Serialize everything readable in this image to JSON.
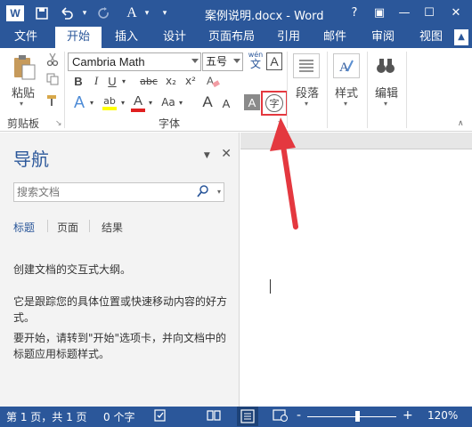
{
  "window": {
    "title": "案例说明.docx - Word",
    "help": "?",
    "ribbon_display": "▣",
    "minimize": "—",
    "maximize": "☐",
    "close": "✕"
  },
  "quick_access": {
    "app_logo": "W",
    "undo_arrow": "▾",
    "customize": "▾"
  },
  "tabs": {
    "file": "文件",
    "items": [
      "开始",
      "插入",
      "设计",
      "页面布局",
      "引用",
      "邮件",
      "审阅",
      "视图"
    ],
    "active": "开始"
  },
  "ribbon": {
    "clipboard": {
      "paste_label": "粘贴",
      "group_label": "剪贴板"
    },
    "font": {
      "font_name": "Cambria Math",
      "font_size": "五号",
      "wen_top": "wén",
      "wen_char": "文",
      "bold": "B",
      "italic": "I",
      "underline": "U",
      "strike": "abc",
      "sub": "x₂",
      "sup": "x²",
      "clear_fmt": "A",
      "text_effect": "A",
      "highlight": "ab",
      "font_color": "A",
      "grow": "A",
      "shrink": "A",
      "change_case": "Aa",
      "char_shading": "A",
      "enclosed_char": "字",
      "border_char": "A",
      "group_label": "字体"
    },
    "paragraph": {
      "label": "段落"
    },
    "styles": {
      "label": "样式"
    },
    "editing": {
      "label": "编辑"
    }
  },
  "nav": {
    "title": "导航",
    "search_placeholder": "搜索文档",
    "tabs": [
      "标题",
      "页面",
      "结果"
    ],
    "p1": "创建文档的交互式大纲。",
    "p2": "它是跟踪您的具体位置或快速移动内容的好方式。",
    "p3": "要开始，请转到\"开始\"选项卡，并向文档中的标题应用标题样式。"
  },
  "status": {
    "page": "第 1 页，共 1 页",
    "words": "0 个字",
    "zoom": "120%",
    "minus": "-",
    "plus": "+"
  },
  "colors": {
    "accent": "#2b579a",
    "highlight_box": "#e4383f",
    "arrow": "#e4383f"
  }
}
